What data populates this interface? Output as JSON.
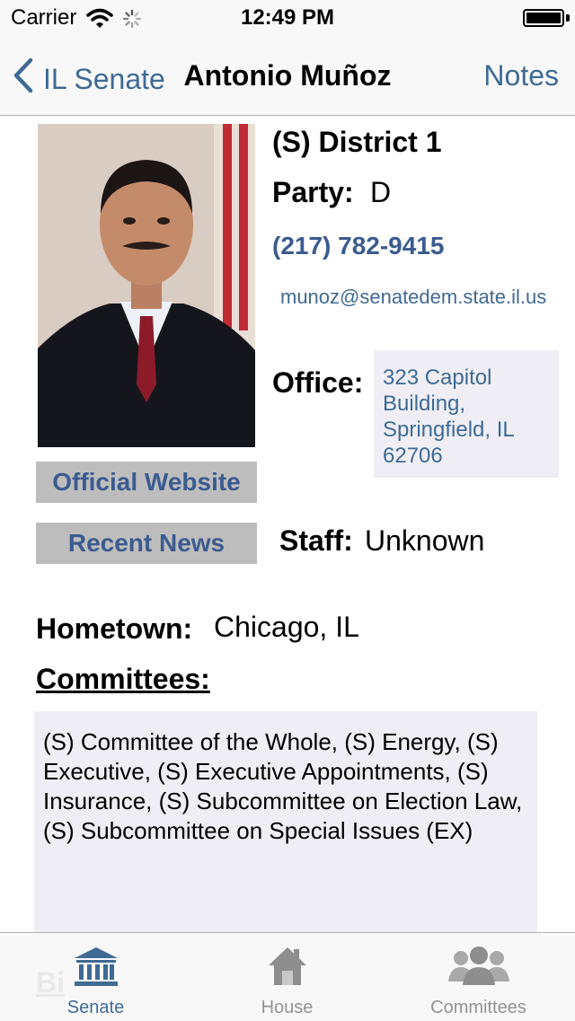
{
  "status_bar": {
    "carrier": "Carrier",
    "time": "12:49 PM"
  },
  "nav": {
    "back_label": "IL Senate",
    "title": "Antonio Muñoz",
    "right_label": "Notes"
  },
  "buttons": {
    "website": "Official Website",
    "news": "Recent News"
  },
  "profile": {
    "district": "(S) District 1",
    "party_label": "Party:",
    "party_value": "D",
    "phone": "(217) 782-9415",
    "email": "munoz@senatedem.state.il.us",
    "office_label": "Office:",
    "office_value": "323 Capitol Building, Springfield, IL 62706",
    "staff_label": "Staff:",
    "staff_value": "Unknown",
    "hometown_label": "Hometown:",
    "hometown_value": "Chicago, IL",
    "committees_label": "Committees:",
    "committees_value": "(S) Committee of the Whole, (S) Energy, (S) Executive, (S) Executive Appointments, (S) Insurance, (S) Subcommittee on Election Law, (S) Subcommittee on Special Issues (EX)",
    "next_section_peek": "Bi"
  },
  "tabs": [
    {
      "label": "Senate",
      "icon": "capitol-building-icon",
      "active": true
    },
    {
      "label": "House",
      "icon": "house-icon",
      "active": false
    },
    {
      "label": "Committees",
      "icon": "people-group-icon",
      "active": false
    }
  ],
  "colors": {
    "link": "#3f6a94",
    "button_bg": "#bdbdbd",
    "box_bg": "#eeeef4",
    "button_text": "#3b5b8f"
  }
}
